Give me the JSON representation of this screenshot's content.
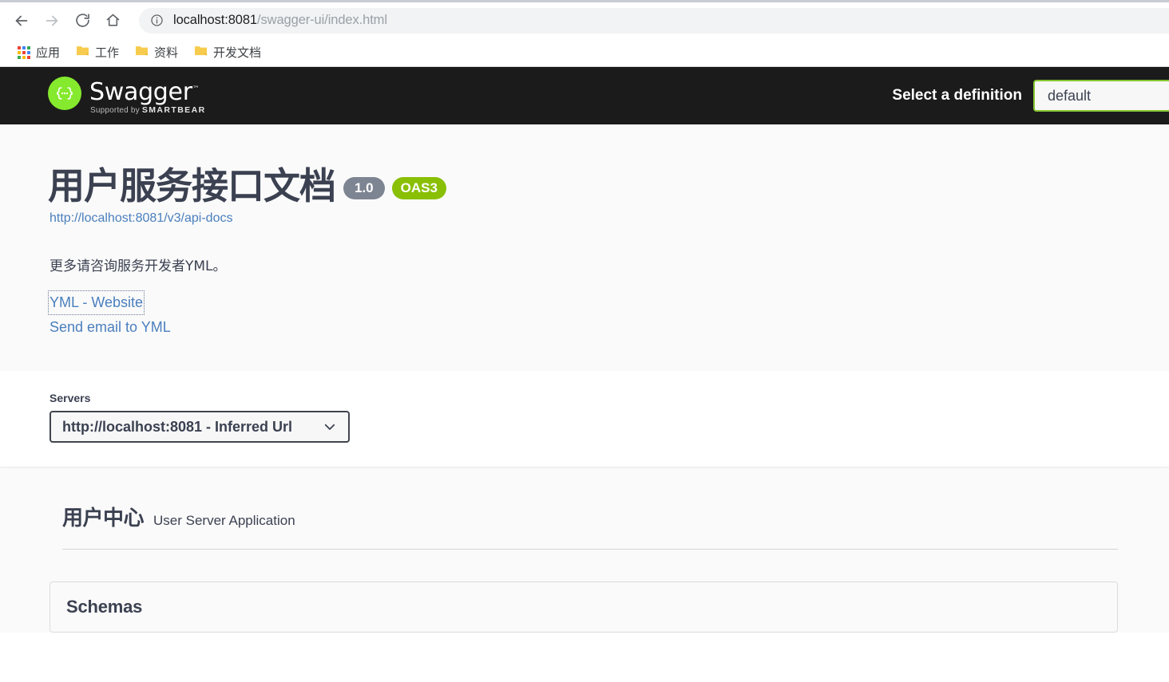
{
  "browser": {
    "nav": {
      "back_icon": "arrow-left-icon",
      "forward_icon": "arrow-right-icon",
      "reload_icon": "reload-icon",
      "home_icon": "home-icon"
    },
    "omnibox": {
      "info_icon": "info-circle-icon",
      "url_host": "localhost:8081",
      "url_path": "/swagger-ui/index.html"
    },
    "bookmarks": [
      {
        "label": "应用",
        "icon": "apps-grid-icon"
      },
      {
        "label": "工作",
        "icon": "folder-icon"
      },
      {
        "label": "资料",
        "icon": "folder-icon"
      },
      {
        "label": "开发文档",
        "icon": "folder-icon"
      }
    ]
  },
  "topbar": {
    "logo_word": "Swagger",
    "logo_tm": "™",
    "logo_sub_prefix": "Supported by",
    "logo_sub_brand": "SMARTBEAR",
    "logo_glyph": "{···}",
    "definition_label": "Select a definition",
    "definition_value": "default",
    "definition_options": [
      "default"
    ]
  },
  "info": {
    "title": "用户服务接口文档",
    "version_badge": "1.0",
    "oas_badge": "OAS3",
    "api_docs_url": "http://localhost:8081/v3/api-docs",
    "description": "更多请咨询服务开发者YML。",
    "website_link": "YML - Website",
    "email_link": "Send email to YML"
  },
  "servers": {
    "label": "Servers",
    "selected": "http://localhost:8081 - Inferred Url",
    "options": [
      "http://localhost:8081 - Inferred Url"
    ],
    "chevron_icon": "chevron-down-icon"
  },
  "tags": [
    {
      "name": "用户中心",
      "description": "User Server Application"
    }
  ],
  "schemas": {
    "title": "Schemas"
  },
  "colors": {
    "swagger_green": "#85ea2d",
    "oas_badge_green": "#89bf04",
    "version_badge_gray": "#7d8492",
    "topbar_black": "#1b1b1b",
    "text_primary": "#3b4151",
    "link_blue": "#4a7fbd",
    "page_gray": "#fafafa"
  }
}
